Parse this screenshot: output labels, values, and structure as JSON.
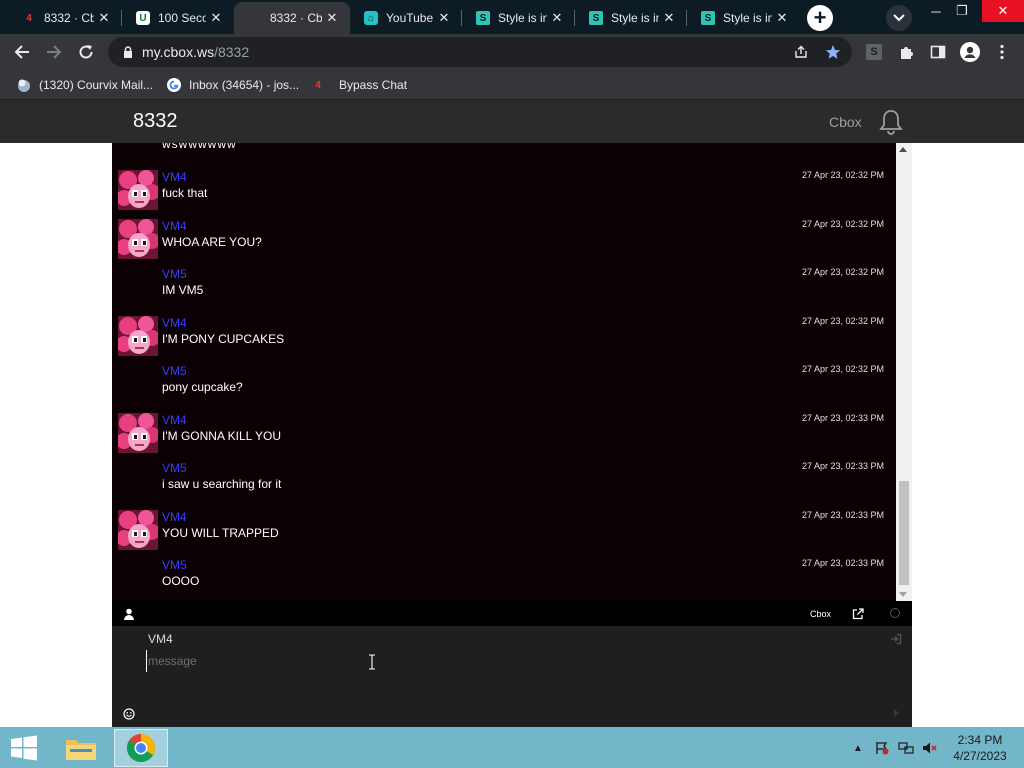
{
  "browser": {
    "tabs": [
      {
        "title": "8332 · Cb",
        "favicon": "cbox-red-icon"
      },
      {
        "title": "100 Seco",
        "favicon": "shield-icon"
      },
      {
        "title": "8332 · Cb",
        "favicon": "cbox-red-icon",
        "active": true
      },
      {
        "title": "YouTube",
        "favicon": "teal-app-icon"
      },
      {
        "title": "Style is in",
        "favicon": "s-logo-icon"
      },
      {
        "title": "Style is in",
        "favicon": "s-logo-icon"
      },
      {
        "title": "Style is in",
        "favicon": "s-logo-icon"
      }
    ],
    "favicon_text": {
      "cbox": "4",
      "shield": "U",
      "s": "S"
    },
    "address": {
      "domain": "my.cbox.ws",
      "path": "/8332"
    },
    "bookmarks": [
      {
        "label": "(1320) Courvix Mail...",
        "icon": "mail-bird-icon"
      },
      {
        "label": "Inbox (34654) - jos...",
        "icon": "google-g-icon"
      },
      {
        "label": "Bypass Chat",
        "icon": "cbox-red-icon",
        "icon_text": "4"
      }
    ]
  },
  "cbox": {
    "title": "8332",
    "brand": "Cbox",
    "partial_top_text": "wswwwwww",
    "messages": [
      {
        "user": "VM4",
        "text": "fuck that",
        "time": "27 Apr 23, 02:32 PM",
        "avatar": true
      },
      {
        "user": "VM4",
        "text": "WHOA ARE YOU?",
        "time": "27 Apr 23, 02:32 PM",
        "avatar": true
      },
      {
        "user": "VM5",
        "text": "IM VM5",
        "time": "27 Apr 23, 02:32 PM",
        "avatar": false
      },
      {
        "user": "VM4",
        "text": "I'M PONY CUPCAKES",
        "time": "27 Apr 23, 02:32 PM",
        "avatar": true
      },
      {
        "user": "VM5",
        "text": "pony cupcake?",
        "time": "27 Apr 23, 02:32 PM",
        "avatar": false
      },
      {
        "user": "VM4",
        "text": "I'M GONNA KILL YOU",
        "time": "27 Apr 23, 02:33 PM",
        "avatar": true
      },
      {
        "user": "VM5",
        "text": "i saw u searching for it",
        "time": "27 Apr 23, 02:33 PM",
        "avatar": false
      },
      {
        "user": "VM4",
        "text": "YOU WILL TRAPPED",
        "time": "27 Apr 23, 02:33 PM",
        "avatar": true
      },
      {
        "user": "VM5",
        "text": "OOOO",
        "time": "27 Apr 23, 02:33 PM",
        "avatar": false
      }
    ],
    "footer_brand": "Cbox",
    "input": {
      "name": "VM4",
      "placeholder": "message",
      "value": ""
    }
  },
  "taskbar": {
    "time": "2:34 PM",
    "date": "4/27/2023"
  },
  "colors": {
    "chat_bg": "#0b0004",
    "username": "#3b3bff",
    "taskbar": "#74b6c9",
    "header": "#2b2b2b"
  }
}
